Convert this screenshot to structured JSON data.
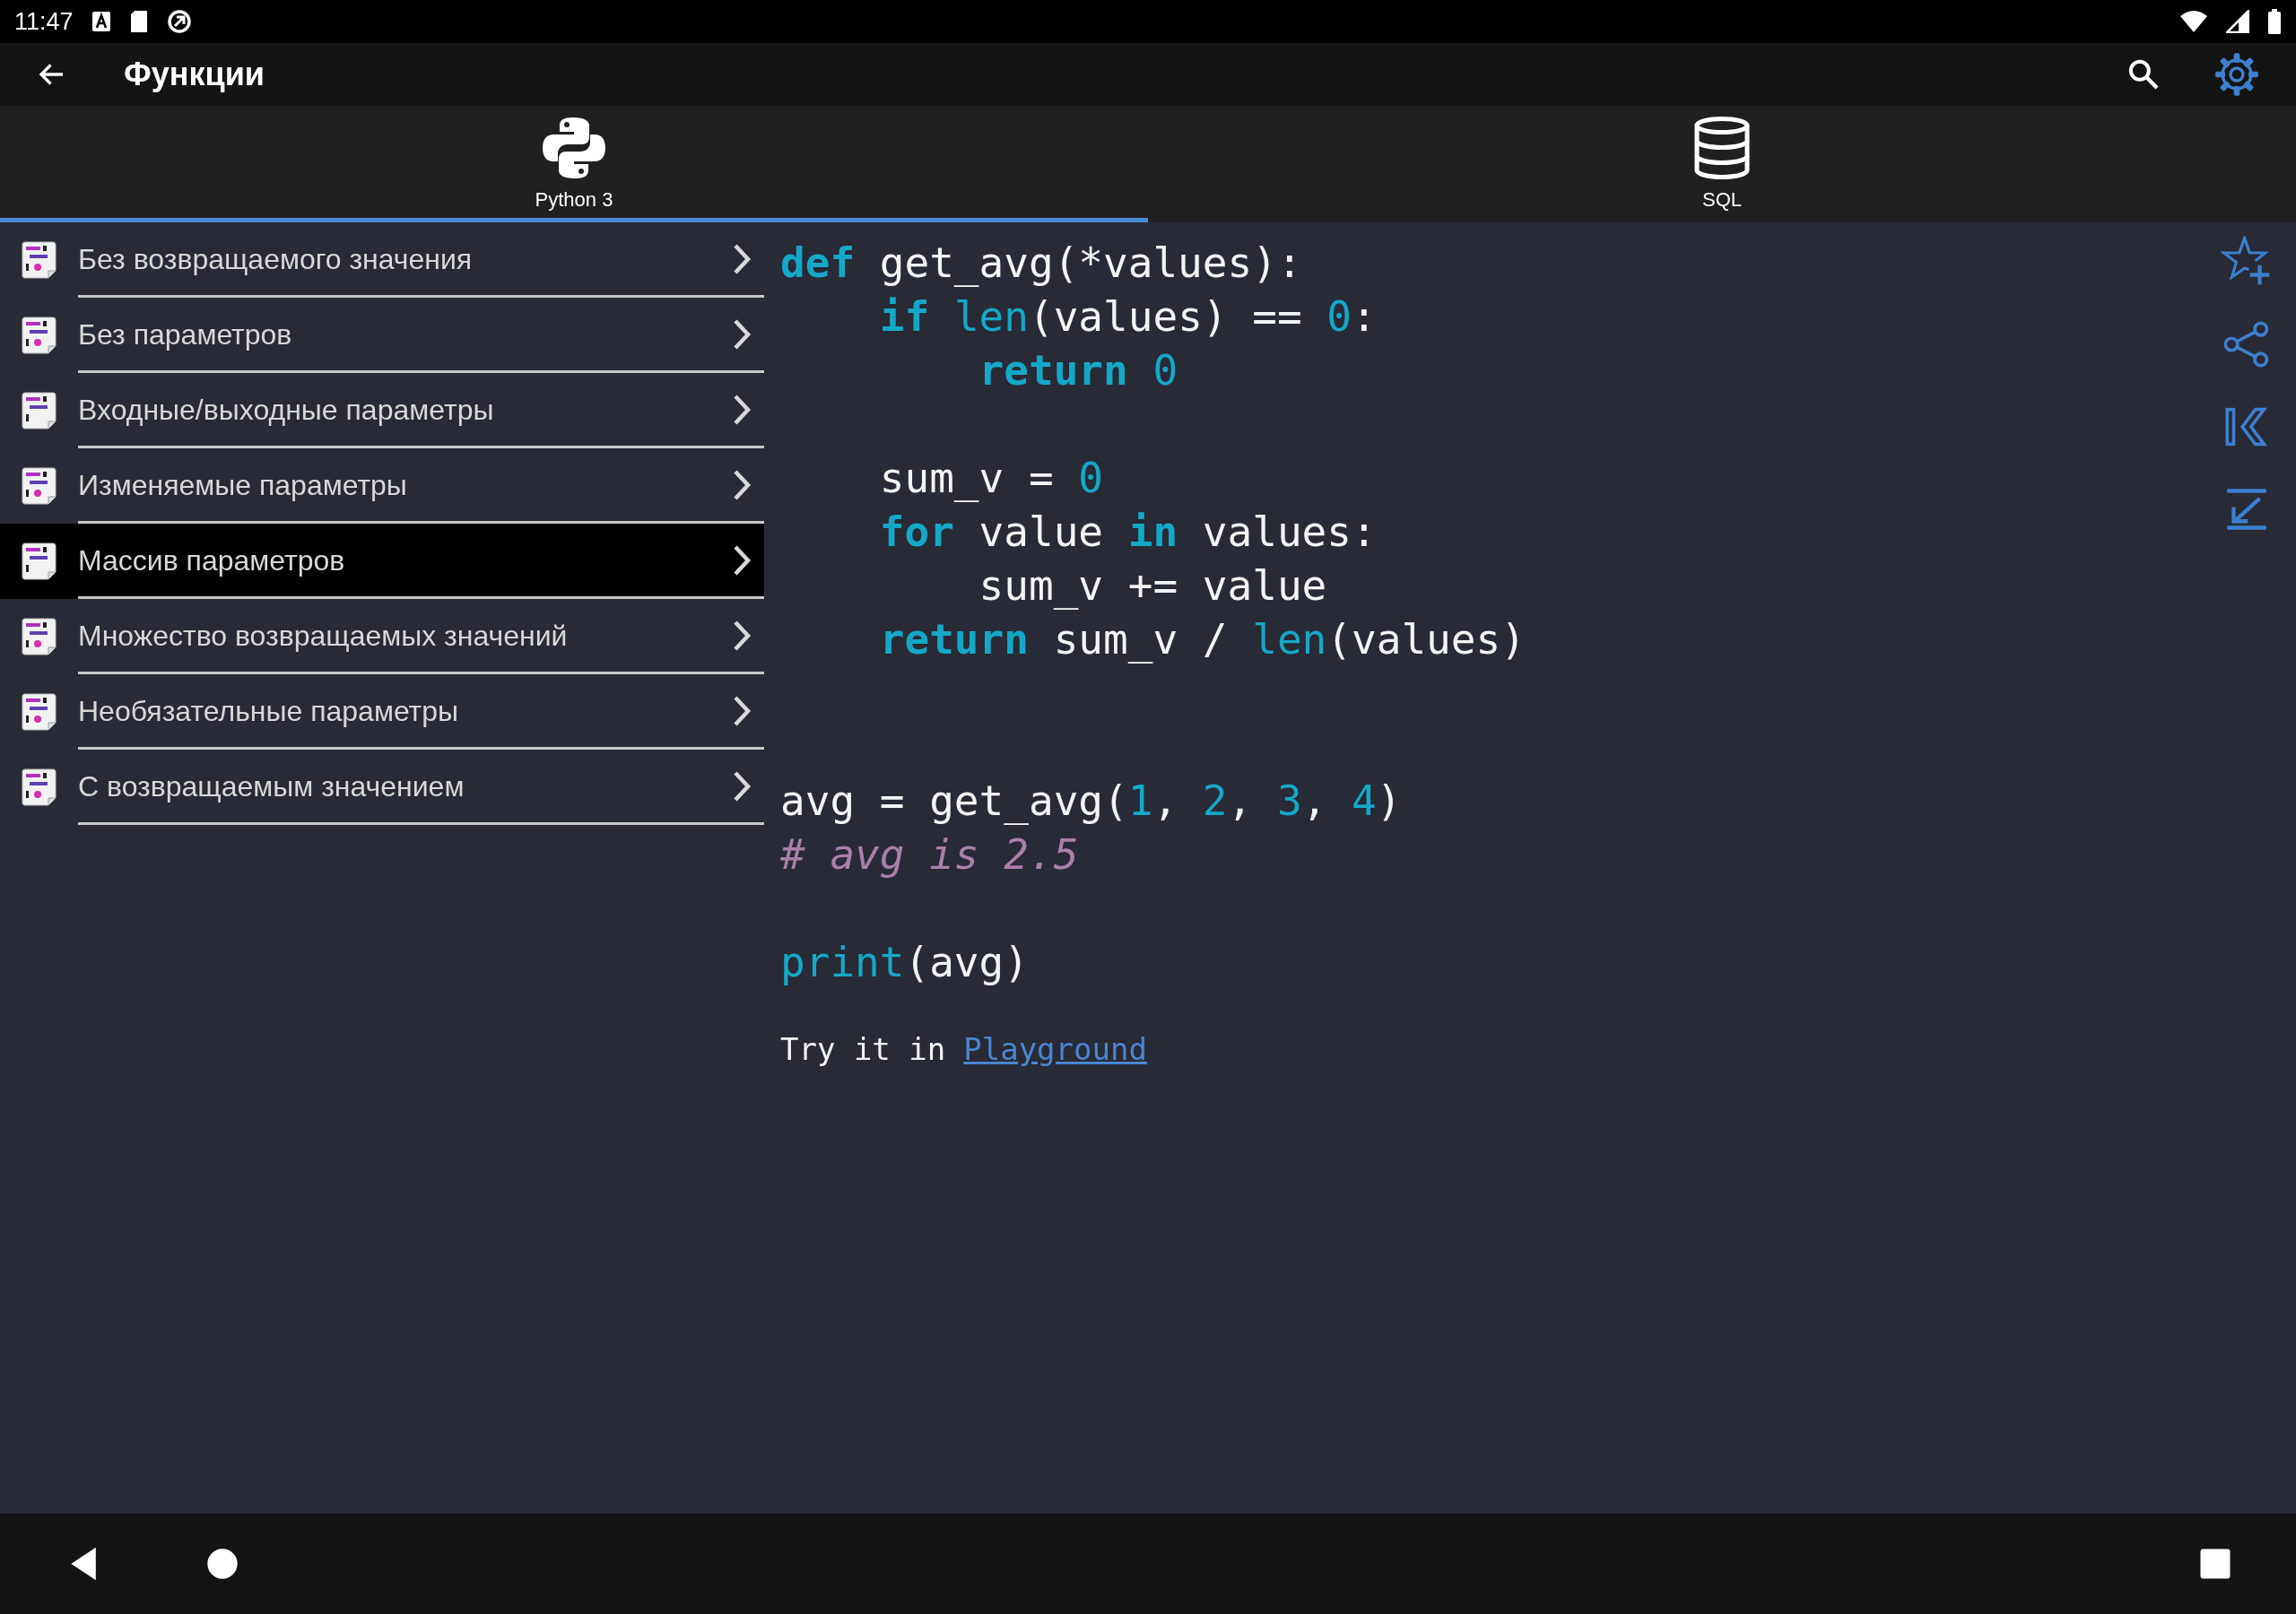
{
  "status_bar": {
    "time": "11:47"
  },
  "toolbar": {
    "title": "Функции"
  },
  "tabs": [
    {
      "label": "Python 3",
      "kind": "python",
      "selected": true
    },
    {
      "label": "SQL",
      "kind": "database",
      "selected": false
    }
  ],
  "topics": [
    {
      "label": "Без возвращаемого значения",
      "selected": false,
      "dot": true
    },
    {
      "label": "Без параметров",
      "selected": false,
      "dot": true
    },
    {
      "label": "Входные/выходные параметры",
      "selected": false,
      "dot": false
    },
    {
      "label": "Изменяемые параметры",
      "selected": false,
      "dot": true
    },
    {
      "label": "Массив параметров",
      "selected": true,
      "dot": false
    },
    {
      "label": "Множество возвращаемых значений",
      "selected": false,
      "dot": true
    },
    {
      "label": "Необязательные параметры",
      "selected": false,
      "dot": true
    },
    {
      "label": "С возвращаемым значением",
      "selected": false,
      "dot": true
    }
  ],
  "code_lines": [
    {
      "kind": "code",
      "tokens": [
        {
          "text": "def",
          "kind": "keyword"
        },
        {
          "text": " get_avg(*values):",
          "kind": "plain"
        }
      ]
    },
    {
      "kind": "code",
      "tokens": [
        {
          "text": "    if ",
          "kind": "keyword"
        },
        {
          "text": "len",
          "kind": "builtin"
        },
        {
          "text": "(values) == ",
          "kind": "plain"
        },
        {
          "text": "0",
          "kind": "number"
        },
        {
          "text": ":",
          "kind": "plain"
        }
      ]
    },
    {
      "kind": "code",
      "tokens": [
        {
          "text": "        return ",
          "kind": "keyword"
        },
        {
          "text": "0",
          "kind": "number"
        }
      ]
    },
    {
      "kind": "blank"
    },
    {
      "kind": "code",
      "tokens": [
        {
          "text": "    sum_v = ",
          "kind": "plain"
        },
        {
          "text": "0",
          "kind": "number"
        }
      ]
    },
    {
      "kind": "code",
      "tokens": [
        {
          "text": "    for",
          "kind": "keyword"
        },
        {
          "text": " value ",
          "kind": "plain"
        },
        {
          "text": "in",
          "kind": "keyword"
        },
        {
          "text": " values:",
          "kind": "plain"
        }
      ]
    },
    {
      "kind": "code",
      "tokens": [
        {
          "text": "        sum_v += value",
          "kind": "plain"
        }
      ]
    },
    {
      "kind": "code",
      "tokens": [
        {
          "text": "    return",
          "kind": "keyword"
        },
        {
          "text": " sum_v / ",
          "kind": "plain"
        },
        {
          "text": "len",
          "kind": "builtin"
        },
        {
          "text": "(values)",
          "kind": "plain"
        }
      ]
    },
    {
      "kind": "blank"
    },
    {
      "kind": "blank"
    },
    {
      "kind": "code",
      "tokens": [
        {
          "text": "avg = get_avg(",
          "kind": "plain"
        },
        {
          "text": "1",
          "kind": "number"
        },
        {
          "text": ", ",
          "kind": "plain"
        },
        {
          "text": "2",
          "kind": "number"
        },
        {
          "text": ", ",
          "kind": "plain"
        },
        {
          "text": "3",
          "kind": "number"
        },
        {
          "text": ", ",
          "kind": "plain"
        },
        {
          "text": "4",
          "kind": "number"
        },
        {
          "text": ")",
          "kind": "plain"
        }
      ]
    },
    {
      "kind": "code",
      "tokens": [
        {
          "text": "# avg is 2.5",
          "kind": "comment"
        }
      ]
    },
    {
      "kind": "blank"
    },
    {
      "kind": "code",
      "tokens": [
        {
          "text": "print",
          "kind": "builtin"
        },
        {
          "text": "(avg)",
          "kind": "plain"
        }
      ]
    }
  ],
  "playground": {
    "text": "Try it in",
    "link": "Playground"
  }
}
